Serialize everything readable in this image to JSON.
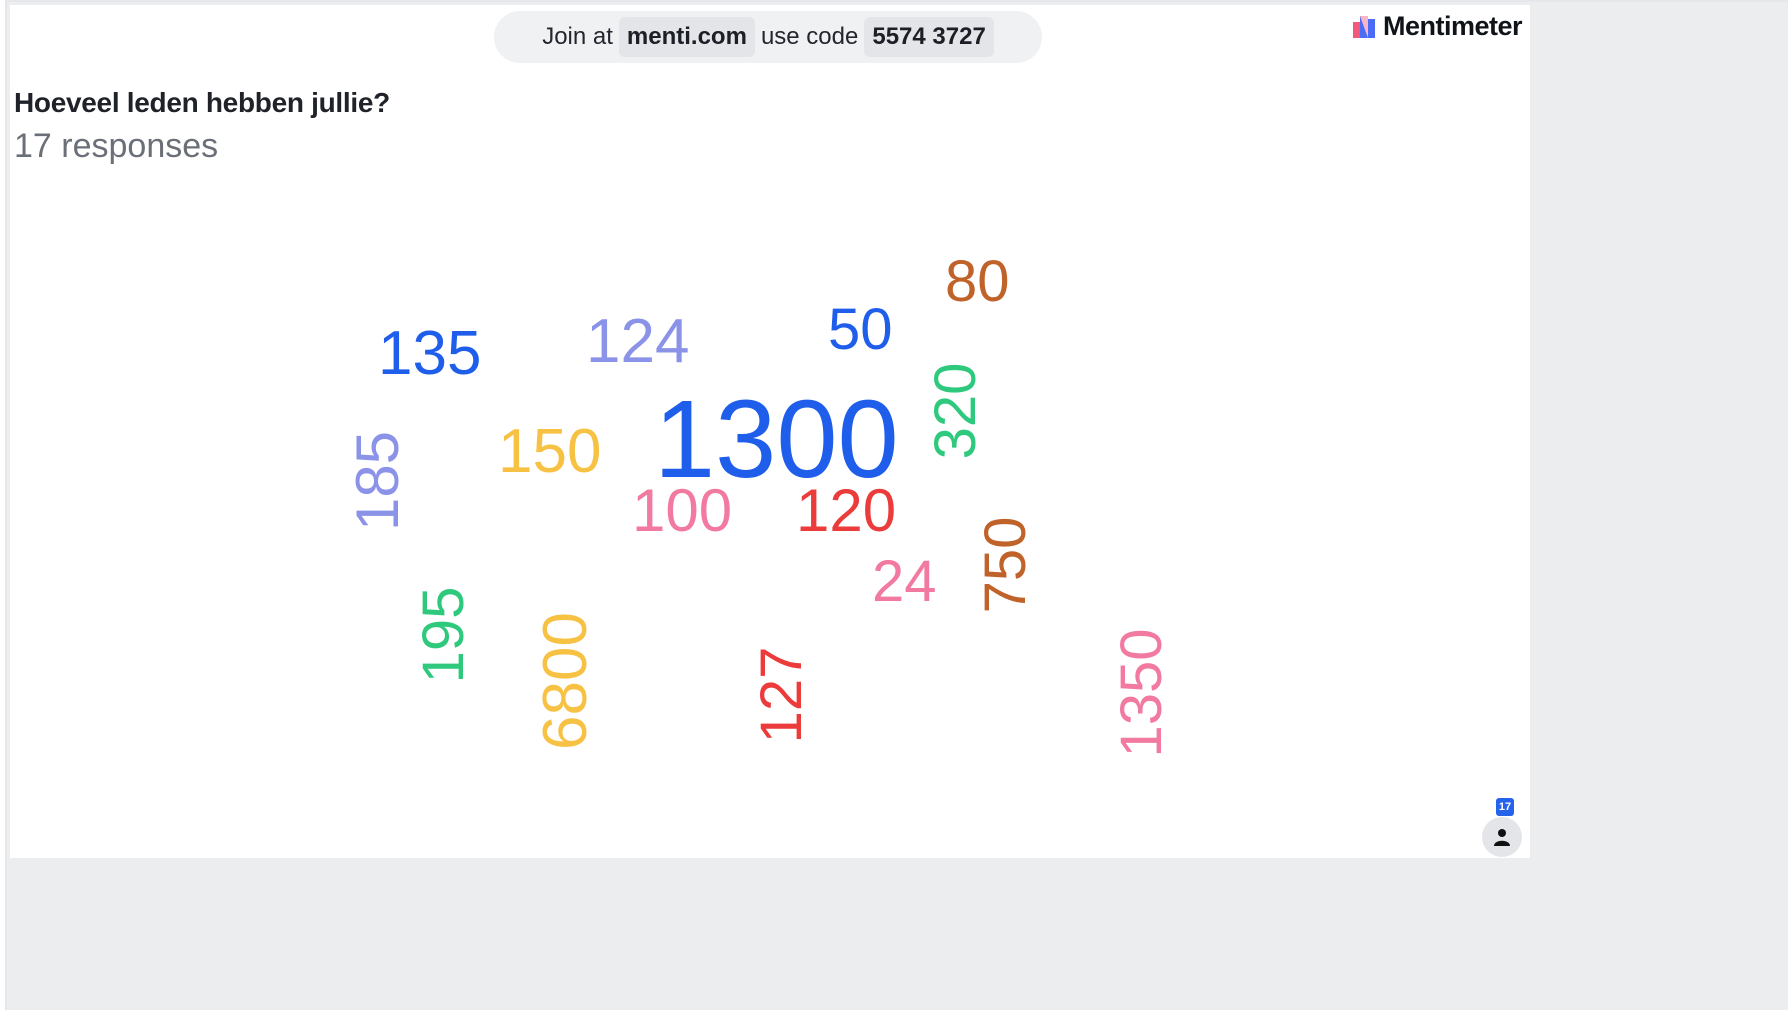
{
  "join": {
    "prefix": "Join at",
    "url": "menti.com",
    "code_label": "use code",
    "code": "5574 3727"
  },
  "brand": {
    "name": "Mentimeter",
    "icon": "mentimeter-logo-icon"
  },
  "question": {
    "title": "Hoeveel leden hebben jullie?",
    "responses": "17 responses"
  },
  "participants": {
    "count": "17",
    "icon": "person-icon"
  },
  "colors": {
    "blue": "#1f5eea",
    "lavender": "#8b93e8",
    "yellow": "#f7c244",
    "pink": "#f27aa0",
    "red": "#eb3b3b",
    "green": "#2ec97d",
    "brown": "#c0632a",
    "background": "#ecedef"
  },
  "words": [
    {
      "text": "80",
      "color": "#c0632a"
    },
    {
      "text": "50",
      "color": "#1f5eea"
    },
    {
      "text": "124",
      "color": "#8b93e8"
    },
    {
      "text": "135",
      "color": "#1f5eea"
    },
    {
      "text": "320",
      "color": "#2ec97d"
    },
    {
      "text": "185",
      "color": "#8b93e8"
    },
    {
      "text": "1300",
      "color": "#1f5eea"
    },
    {
      "text": "150",
      "color": "#f7c244"
    },
    {
      "text": "100",
      "color": "#f27aa0"
    },
    {
      "text": "120",
      "color": "#eb3b3b"
    },
    {
      "text": "750",
      "color": "#c0632a"
    },
    {
      "text": "195",
      "color": "#2ec97d"
    },
    {
      "text": "6800",
      "color": "#f7c244"
    },
    {
      "text": "24",
      "color": "#f27aa0"
    },
    {
      "text": "127",
      "color": "#eb3b3b"
    },
    {
      "text": "1350",
      "color": "#f27aa0"
    }
  ]
}
